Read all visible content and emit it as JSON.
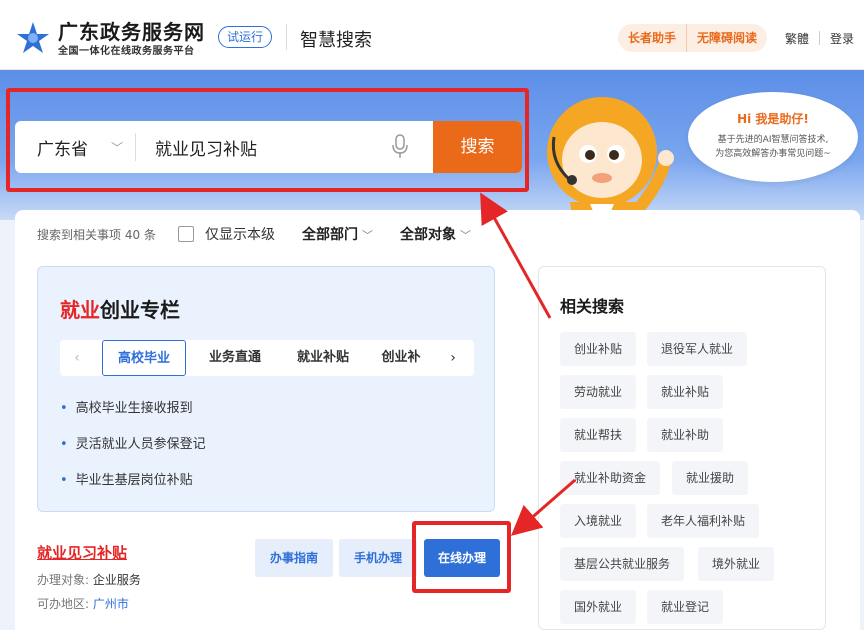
{
  "header": {
    "site_title": "广东政务服务网",
    "site_subtitle": "全国一体化在线政务服务平台",
    "trial_badge": "试运行",
    "section_title": "智慧搜索",
    "elder_mode": "长者助手",
    "accessible_reading": "无障碍阅读",
    "traditional": "繁體",
    "login": "登录"
  },
  "search": {
    "region": "广东省",
    "query": "就业见习补贴",
    "button": "搜索"
  },
  "assistant_bubble": {
    "title": "Hi 我是助仔!",
    "line1": "基于先进的AI智慧问答技术,",
    "line2": "为您高效解答办事常见问题~"
  },
  "filters": {
    "result_count": "搜索到相关事项 40 条",
    "only_this_level": "仅显示本级",
    "all_departments": "全部部门",
    "all_targets": "全部对象"
  },
  "column_card": {
    "title_highlight": "就业",
    "title_rest": "创业专栏",
    "tabs": [
      "高校毕业",
      "业务直通",
      "就业补贴",
      "创业补"
    ],
    "bullets": [
      "高校毕业生接收报到",
      "灵活就业人员参保登记",
      "毕业生基层岗位补贴"
    ]
  },
  "result_item": {
    "title": "就业见习补贴",
    "target_label": "办理对象:",
    "target_value": "企业服务",
    "area_label": "可办地区:",
    "area_value": "广州市",
    "guide_button": "办事指南",
    "mobile_button": "手机办理",
    "online_button": "在线办理"
  },
  "related": {
    "title": "相关搜索",
    "chips": [
      "创业补贴",
      "退役军人就业",
      "劳动就业",
      "就业补贴",
      "就业帮扶",
      "就业补助",
      "就业补助资金",
      "就业援助",
      "入境就业",
      "老年人福利补贴",
      "基层公共就业服务",
      "境外就业",
      "国外就业",
      "就业登记"
    ]
  },
  "colors": {
    "accent_blue": "#2f6fd8",
    "accent_orange": "#ea6a1a",
    "highlight_red": "#e42626"
  }
}
